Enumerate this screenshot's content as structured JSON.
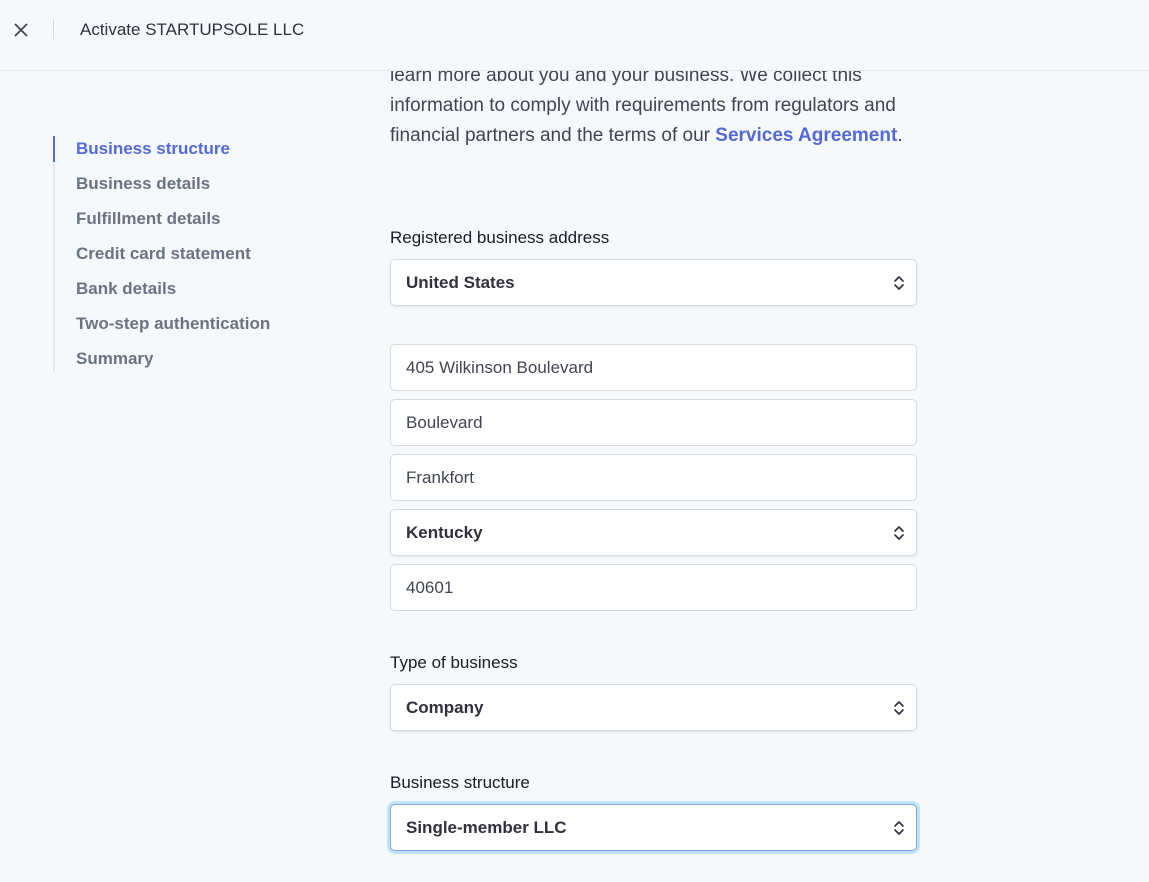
{
  "header": {
    "close_icon": "close-icon",
    "title": "Activate STARTUPSOLE LLC"
  },
  "sidebar": {
    "items": [
      {
        "label": "Business structure",
        "active": true
      },
      {
        "label": "Business details",
        "active": false
      },
      {
        "label": "Fulfillment details",
        "active": false
      },
      {
        "label": "Credit card statement",
        "active": false
      },
      {
        "label": "Bank details",
        "active": false
      },
      {
        "label": "Two-step authentication",
        "active": false
      },
      {
        "label": "Summary",
        "active": false
      }
    ]
  },
  "intro": {
    "text_before_link": "learn more about you and your business. We collect this information to comply with requirements from regulators and financial partners and the terms of our ",
    "link_text": "Services Agreement",
    "text_after_link": "."
  },
  "address": {
    "label": "Registered business address",
    "country": "United States",
    "line1": "405 Wilkinson Boulevard",
    "line2": "Boulevard",
    "city": "Frankfort",
    "state": "Kentucky",
    "zip": "40601"
  },
  "business_type": {
    "label": "Type of business",
    "value": "Company"
  },
  "business_structure": {
    "label": "Business structure",
    "value": "Single-member LLC"
  },
  "colors": {
    "accent": "#5469d4",
    "background": "#f6f9fc",
    "nav_inactive": "#6a7383",
    "focus_ring": "#7fa7e0"
  }
}
